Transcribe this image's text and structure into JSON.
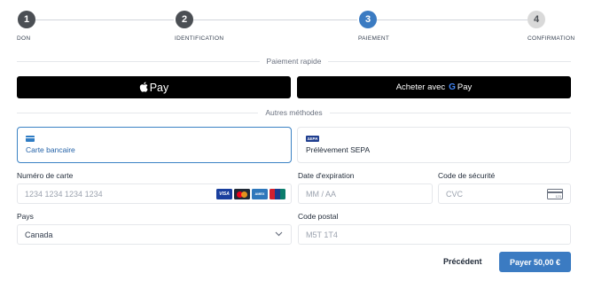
{
  "stepper": {
    "steps": [
      {
        "number": "1",
        "label": "DON",
        "state": "done"
      },
      {
        "number": "2",
        "label": "IDENTIFICATION",
        "state": "done"
      },
      {
        "number": "3",
        "label": "PAIEMENT",
        "state": "active"
      },
      {
        "number": "4",
        "label": "CONFIRMATION",
        "state": "upcoming"
      }
    ],
    "colors": {
      "done": "#4b4f54",
      "active": "#3b7bc2",
      "upcoming": "#d9d9d9"
    }
  },
  "express": {
    "title": "Paiement rapide",
    "apple_pay_label": "Pay",
    "google_pay_label": "Acheter avec",
    "google_pay_g": "G",
    "google_pay_suffix": "Pay"
  },
  "methods": {
    "title": "Autres méthodes",
    "options": [
      {
        "label": "Carte bancaire",
        "icon": "credit-card-icon",
        "selected": true
      },
      {
        "label": "Prélèvement SEPA",
        "icon": "sepa-icon",
        "selected": false
      }
    ],
    "sepa_badge": "SEPA"
  },
  "form": {
    "card_number": {
      "label": "Numéro de carte",
      "placeholder": "1234 1234 1234 1234"
    },
    "card_brands": [
      "VISA",
      "Mastercard",
      "AMEX",
      "UnionPay"
    ],
    "expiry": {
      "label": "Date d'expiration",
      "placeholder": "MM / AA"
    },
    "security_code": {
      "label": "Code de sécurité",
      "placeholder": "CVC",
      "icon_text": "123"
    },
    "country": {
      "label": "Pays",
      "value": "Canada"
    },
    "postal_code": {
      "label": "Code postal",
      "placeholder": "M5T 1T4"
    }
  },
  "footer": {
    "previous_label": "Précédent",
    "pay_label": "Payer 50,00 €"
  },
  "colors": {
    "accent": "#3b7bc2",
    "black": "#000000"
  }
}
